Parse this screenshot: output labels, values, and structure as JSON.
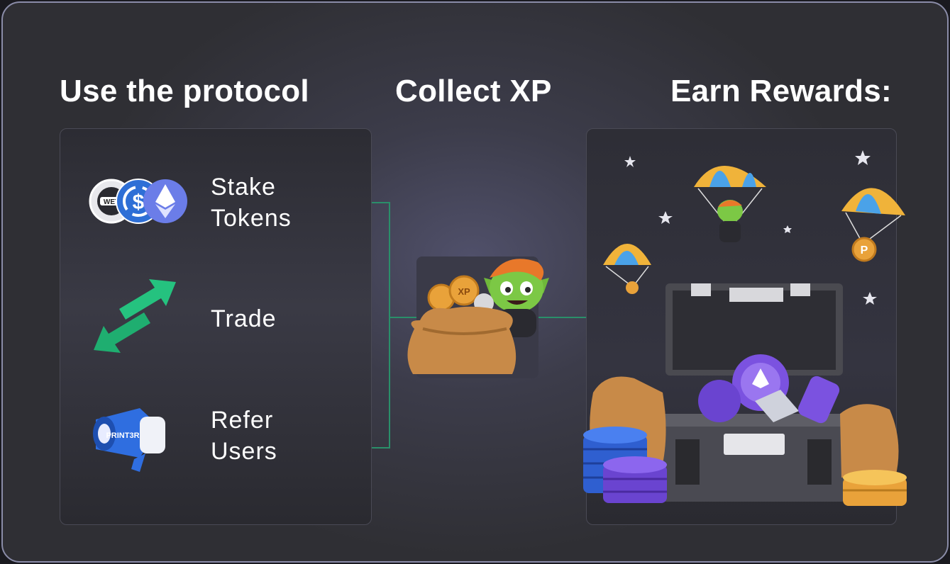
{
  "headings": {
    "left": "Use the protocol",
    "middle": "Collect XP",
    "right": "Earn Rewards:"
  },
  "actions": [
    {
      "label_line1": "Stake",
      "label_line2": "Tokens",
      "icon": "token-stack-icon"
    },
    {
      "label_line1": "Trade",
      "label_line2": "",
      "icon": "swap-arrows-icon"
    },
    {
      "label_line1": "Refer",
      "label_line2": "Users",
      "icon": "megaphone-icon"
    }
  ],
  "icons": {
    "token_badge_text": "WET",
    "megaphone_text": "PRINT3R",
    "xp_coin_text": "XP",
    "reward_coin_text": "P"
  },
  "colors": {
    "accent_green": "#1f9e6e",
    "connector_green": "#2a8f6a",
    "coin_gold": "#e9a23a",
    "coin_purple": "#7b52e0",
    "coin_blue": "#3a6fe0"
  }
}
